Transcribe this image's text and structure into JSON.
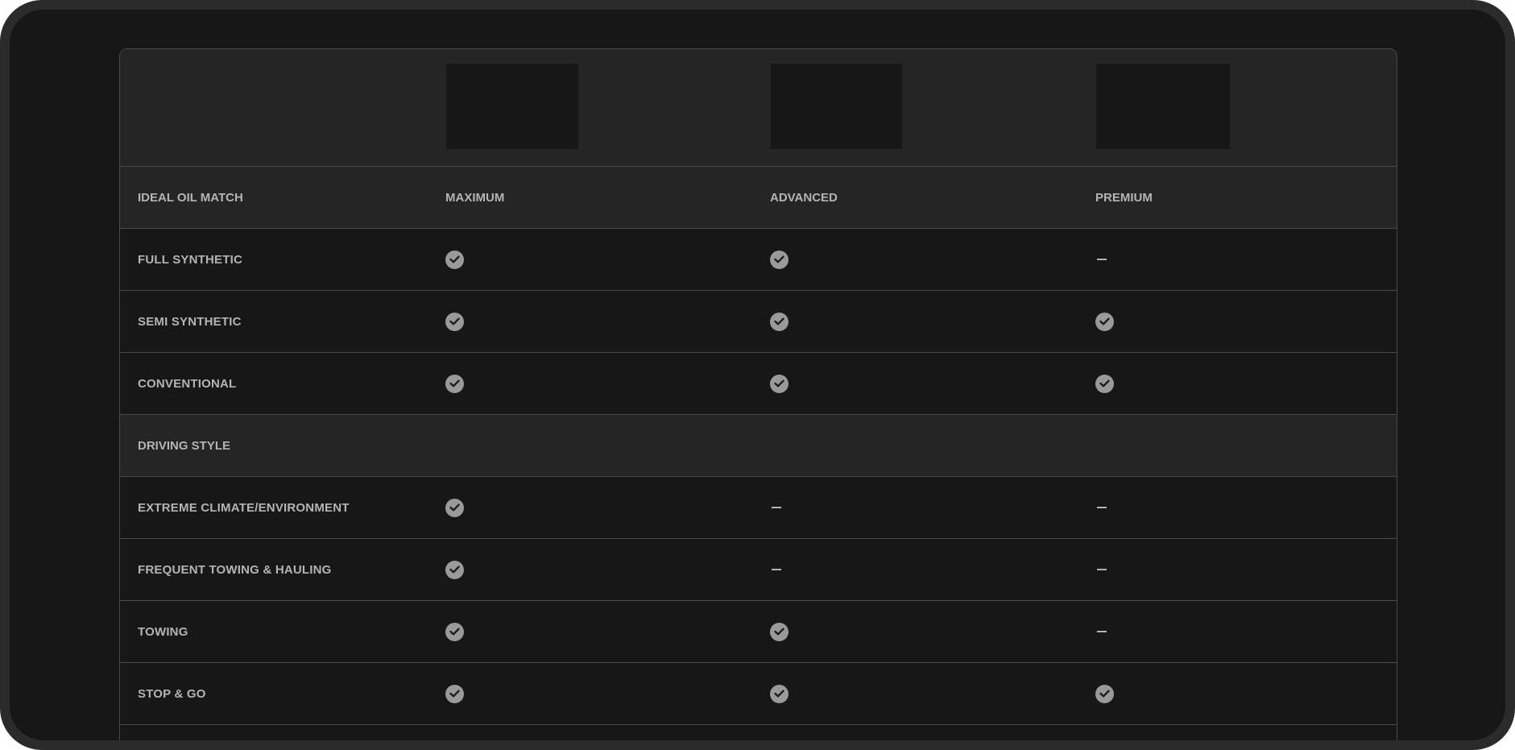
{
  "products": [
    {
      "name": "MAXIMUM"
    },
    {
      "name": "ADVANCED"
    },
    {
      "name": "PREMIUM"
    }
  ],
  "sections": [
    {
      "title": "IDEAL OIL MATCH",
      "rows": [
        {
          "label": "FULL SYNTHETIC",
          "values": [
            "check",
            "check",
            "dash"
          ]
        },
        {
          "label": "SEMI SYNTHETIC",
          "values": [
            "check",
            "check",
            "check"
          ]
        },
        {
          "label": "CONVENTIONAL",
          "values": [
            "check",
            "check",
            "check"
          ]
        }
      ]
    },
    {
      "title": "DRIVING STYLE",
      "rows": [
        {
          "label": "EXTREME CLIMATE/ENVIRONMENT",
          "values": [
            "check",
            "dash",
            "dash"
          ]
        },
        {
          "label": "FREQUENT TOWING & HAULING",
          "values": [
            "check",
            "dash",
            "dash"
          ]
        },
        {
          "label": "TOWING",
          "values": [
            "check",
            "check",
            "dash"
          ]
        },
        {
          "label": "STOP & GO",
          "values": [
            "check",
            "check",
            "check"
          ]
        }
      ]
    }
  ],
  "icons": {
    "included": "check-circle-icon",
    "not_included": "dash-icon"
  },
  "colors": {
    "page_bg": "#171717",
    "section_bg": "#252525",
    "border": "#4a4a4a",
    "text": "#b4b4b4",
    "check": "#9a9a9a"
  }
}
